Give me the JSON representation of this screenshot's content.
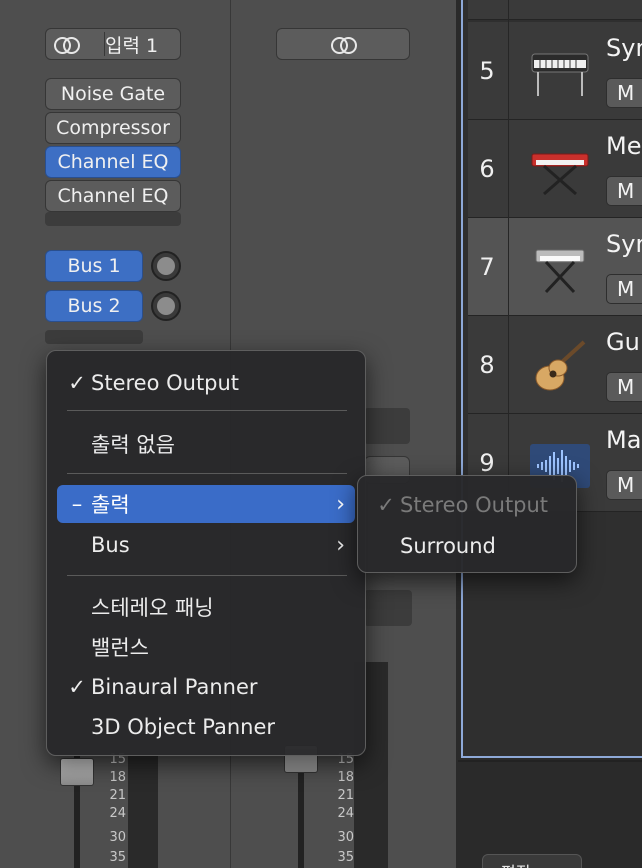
{
  "channel_strip": {
    "input_label": "입력 1",
    "plugins": [
      {
        "label": "Noise Gate",
        "active": false
      },
      {
        "label": "Compressor",
        "active": false
      },
      {
        "label": "Channel EQ",
        "active": true
      },
      {
        "label": "Channel EQ",
        "active": false
      }
    ],
    "sends": [
      {
        "label": "Bus 1"
      },
      {
        "label": "Bus 2"
      }
    ],
    "fader_scale": [
      "15",
      "18",
      "21",
      "24",
      "30",
      "35"
    ]
  },
  "output_menu": {
    "items": {
      "stereo_output": "Stereo Output",
      "no_output": "출력 없음",
      "output": "출력",
      "bus": "Bus",
      "stereo_panning": "스테레오 패닝",
      "balance": "밸런스",
      "binaural_panner": "Binaural Panner",
      "object_panner": "3D Object Panner"
    },
    "check_mark": "✓",
    "dash_mark": "–",
    "chevron": "›",
    "submenu": {
      "stereo_output": "Stereo Output",
      "surround": "Surround"
    }
  },
  "tracks": [
    {
      "number": "5",
      "name": "Syn",
      "mute": "M",
      "icon": "electric-piano-icon"
    },
    {
      "number": "6",
      "name": "Mel",
      "mute": "M",
      "icon": "red-keyboard-icon"
    },
    {
      "number": "7",
      "name": "Syn",
      "mute": "M",
      "icon": "synth-keyboard-icon",
      "selected": true
    },
    {
      "number": "8",
      "name": "Gui",
      "mute": "M",
      "icon": "acoustic-guitar-icon"
    },
    {
      "number": "9",
      "name": "Mas",
      "mute": "M",
      "icon": "waveform-icon"
    }
  ],
  "bottom_tab": "편집"
}
